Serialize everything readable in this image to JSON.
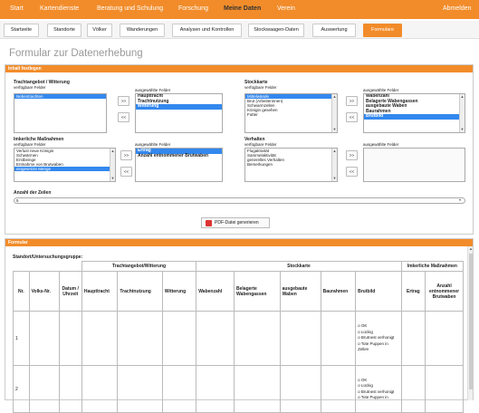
{
  "topnav": {
    "items": [
      "Start",
      "Kartendienste",
      "Beratung und Schulung",
      "Forschung",
      "Meine Daten",
      "Verein"
    ],
    "logout": "Abmelden",
    "active_index": 4,
    "color": "#f28c2a"
  },
  "subnav": {
    "tabs": [
      "Startseite",
      "Standorte",
      "Völker",
      "Wanderungen",
      "Analysen und Kontrollen",
      "Stockwaagen-Daten",
      "Auswertung",
      "Formulare"
    ],
    "active_index": 7
  },
  "page_title": "Formular zur Datenerhebung",
  "inhalt": {
    "header": "Inhalt festlegen",
    "groups": [
      {
        "title": "Trachtangebot / Witterung",
        "available_label": "verfügbare Felder",
        "available": [
          "Nebentrachten"
        ],
        "available_selected": [
          0
        ],
        "selected_label": "ausgewählte Felder",
        "selected": [
          "Haupttracht",
          "Trachtnutzung",
          "Witterung"
        ],
        "selected_selected": [
          2
        ]
      },
      {
        "title": "Stockkarte",
        "available_label": "verfügbare Felder",
        "available": [
          "Mittelwände",
          "Brut (Arbeiterinnen)",
          "Schwarmzellen",
          "Königin gesehen",
          "Futter"
        ],
        "available_selected": [
          0
        ],
        "selected_label": "ausgewählte Felder",
        "selected": [
          "Wabenzahl",
          "Belagerte Wabengassen",
          "ausgebaute Waben",
          "Baurahmen",
          "Brutbild"
        ],
        "selected_selected": [
          4
        ]
      },
      {
        "title": "Imkerliche Maßnahmen",
        "available_label": "verfügbare Felder",
        "available": [
          "Verlust neue Königin",
          "Schwärmen",
          "Erstbeinge",
          "Entnahme von Brutwaben",
          "eingesetzte Menge"
        ],
        "available_selected": [
          4
        ],
        "selected_label": "ausgewählte Felder",
        "selected": [
          "Ertrag",
          "Anzahl entnommener Brutwaben"
        ],
        "selected_selected": [
          0
        ]
      },
      {
        "title": "Verhalten",
        "available_label": "verfügbare Felder",
        "available": [
          "Flugaktivität",
          "Sammelaktivität",
          "generelles Verhalten",
          "Bemerkungen"
        ],
        "available_selected": [],
        "selected_label": "ausgewählte Felder",
        "selected": [],
        "selected_selected": []
      }
    ],
    "add_label": ">>",
    "remove_label": "<<",
    "rows_label": "Anzahl der Zeilen",
    "rows_value": "5",
    "pdf_button": "PDF-Datei generieren"
  },
  "formular": {
    "header": "Formular",
    "group_label": "Standort/Untersuchungsgruppe:",
    "col_groups": [
      "Trachtangebot/Witterung",
      "Stockkarte",
      "Imkerliche Maßnahmen"
    ],
    "columns": [
      "Nr.",
      "Volks-Nr.",
      "Datum / Uhrzeit",
      "Haupttracht",
      "Trachtnutzung",
      "Witterung",
      "Wabenzahl",
      "Belagerte Wabengassen",
      "ausgebaute Waben",
      "Baurahmen",
      "Brutbild",
      "Ertrag",
      "Anzahl entnommener Brutwaben"
    ],
    "rows": [
      {
        "nr": "1",
        "brutbild": [
          "o OK",
          "o Lückig",
          "o Brutnest verhonigt",
          "o Tote Puppen in Zellen"
        ]
      },
      {
        "nr": "2",
        "brutbild": [
          "o OK",
          "o Lückig",
          "o Brutnest verhonigt",
          "o Tote Puppen in"
        ]
      }
    ]
  }
}
